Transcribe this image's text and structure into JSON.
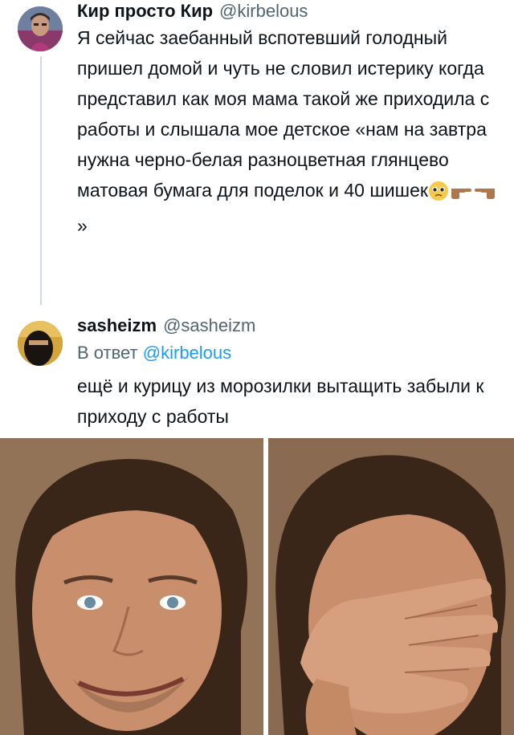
{
  "tweet1": {
    "author_name": "Кир просто Кир",
    "handle": "@kirbelous",
    "text_main": "Я сейчас заебанный вспотевший голодный пришел домой и чуть не словил истерику когда представил как моя мама такой же приходила с работы и слышала мое детское «нам на завтра нужна черно-белая разноцветная глянцево матовая бумага для поделок и 40 шишек",
    "text_end": "»",
    "emojis": [
      "pleading-face",
      "hand-pointing-right",
      "hand-pointing-left"
    ]
  },
  "tweet2": {
    "author_name": "sasheizm",
    "handle": "@sasheizm",
    "reply_prefix": "В ответ",
    "reply_mention": "@kirbelous",
    "text": "ещё и курицу из морозилки вытащить забыли к приходу с работы"
  },
  "meme": {
    "panels": [
      "smiling-face",
      "facepalm"
    ]
  },
  "colors": {
    "text": "#0f1419",
    "secondary": "#536471",
    "link": "#1d9bf0",
    "thread_line": "#cfd9de"
  }
}
